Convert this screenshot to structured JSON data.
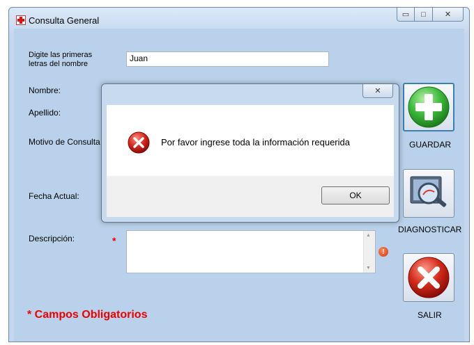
{
  "window": {
    "title": "Consulta General",
    "icon": "red-cross-icon",
    "controls": {
      "minimize": "▭",
      "maximize": "□",
      "close": "✕"
    }
  },
  "form": {
    "search_label_line1": "Digite las primeras",
    "search_label_line2": "letras del nombre",
    "search_value": "Juan",
    "nombre_label": "Nombre:",
    "apellido_label": "Apellido:",
    "motivo_label": "Motivo de Consulta",
    "fecha_label": "Fecha Actual:",
    "descripcion_label": "Descripción:",
    "descripcion_value": "",
    "required_star": "*",
    "error_marker": "!",
    "required_note": "* Campos Obligatorios"
  },
  "actions": {
    "guardar": "GUARDAR",
    "diagnosticar": "DIAGNOSTICAR",
    "salir": "SALIR"
  },
  "dialog": {
    "message": "Por favor ingrese toda la información requerida",
    "ok": "OK",
    "close": "✕",
    "icon": "error-icon"
  },
  "scroll": {
    "up": "▲",
    "down": "▼"
  },
  "colors": {
    "client_bg": "#b9d1ea",
    "required_red": "#e00000",
    "accent_green": "#2fae2f"
  }
}
